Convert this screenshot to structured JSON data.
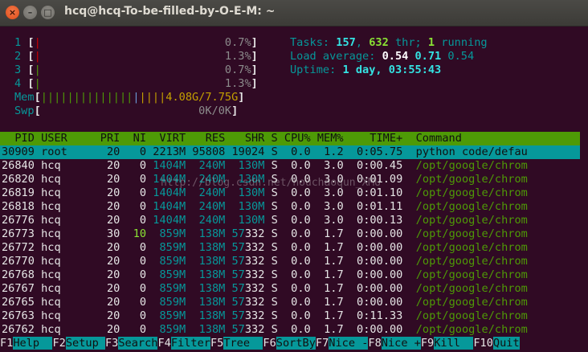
{
  "window": {
    "title": "hcq@hcq-To-be-filled-by-O-E-M: ~"
  },
  "meters": {
    "cpu": [
      {
        "num": "1",
        "bar": "|",
        "pct": "0.7%",
        "level": 0.007
      },
      {
        "num": "2",
        "bar": "|",
        "pct": "1.3%",
        "level": 0.013
      },
      {
        "num": "3",
        "bar": "|",
        "pct": "0.7%",
        "level": 0.007
      },
      {
        "num": "4",
        "bar": "|",
        "pct": "1.3%",
        "level": 0.013
      }
    ],
    "mem": {
      "label": "Mem",
      "bar_green": "||||||||||||||",
      "bar_blue": "|",
      "bar_yellow": "||||",
      "value": "4.08G/7.75G"
    },
    "swp": {
      "label": "Swp",
      "value": "0K/0K"
    }
  },
  "stats": {
    "tasks_label": "Tasks:",
    "tasks": "157",
    "thr": "632",
    "thr_label": "thr;",
    "running": "1",
    "running_label": "running",
    "load_label": "Load average:",
    "load1": "0.54",
    "load5": "0.71",
    "load15": "0.54",
    "uptime_label": "Uptime:",
    "uptime": "1 day, 03:55:43"
  },
  "table": {
    "columns": [
      "PID",
      "USER",
      "PRI",
      "NI",
      "VIRT",
      "RES",
      "SHR",
      "S",
      "CPU%",
      "MEM%",
      "TIME+",
      "Command"
    ],
    "rows": [
      {
        "pid": "30909",
        "user": "root",
        "pri": "20",
        "ni": "0",
        "virt": "2213M",
        "res": "95808",
        "shr": "19024",
        "s": "S",
        "cpu": "0.0",
        "mem": "1.2",
        "time": "0:05.75",
        "cmd": "python code/defau"
      },
      {
        "pid": "26840",
        "user": "hcq",
        "pri": "20",
        "ni": "0",
        "virt": "1404M",
        "res": "240M",
        "shr": "130M",
        "s": "S",
        "cpu": "0.0",
        "mem": "3.0",
        "time": "0:00.45",
        "cmd": "/opt/google/chrom"
      },
      {
        "pid": "26820",
        "user": "hcq",
        "pri": "20",
        "ni": "0",
        "virt": "1404M",
        "res": "240M",
        "shr": "130M",
        "s": "S",
        "cpu": "0.0",
        "mem": "3.0",
        "time": "0:01.09",
        "cmd": "/opt/google/chrom"
      },
      {
        "pid": "26819",
        "user": "hcq",
        "pri": "20",
        "ni": "0",
        "virt": "1404M",
        "res": "240M",
        "shr": "130M",
        "s": "S",
        "cpu": "0.0",
        "mem": "3.0",
        "time": "0:01.10",
        "cmd": "/opt/google/chrom"
      },
      {
        "pid": "26818",
        "user": "hcq",
        "pri": "20",
        "ni": "0",
        "virt": "1404M",
        "res": "240M",
        "shr": "130M",
        "s": "S",
        "cpu": "0.0",
        "mem": "3.0",
        "time": "0:01.11",
        "cmd": "/opt/google/chrom"
      },
      {
        "pid": "26776",
        "user": "hcq",
        "pri": "20",
        "ni": "0",
        "virt": "1404M",
        "res": "240M",
        "shr": "130M",
        "s": "S",
        "cpu": "0.0",
        "mem": "3.0",
        "time": "0:00.13",
        "cmd": "/opt/google/chrom"
      },
      {
        "pid": "26773",
        "user": "hcq",
        "pri": "30",
        "ni": "10",
        "virt": "859M",
        "res": "138M",
        "shr": "57332",
        "s": "S",
        "cpu": "0.0",
        "mem": "1.7",
        "time": "0:00.00",
        "cmd": "/opt/google/chrom"
      },
      {
        "pid": "26772",
        "user": "hcq",
        "pri": "20",
        "ni": "0",
        "virt": "859M",
        "res": "138M",
        "shr": "57332",
        "s": "S",
        "cpu": "0.0",
        "mem": "1.7",
        "time": "0:00.00",
        "cmd": "/opt/google/chrom"
      },
      {
        "pid": "26770",
        "user": "hcq",
        "pri": "20",
        "ni": "0",
        "virt": "859M",
        "res": "138M",
        "shr": "57332",
        "s": "S",
        "cpu": "0.0",
        "mem": "1.7",
        "time": "0:00.00",
        "cmd": "/opt/google/chrom"
      },
      {
        "pid": "26768",
        "user": "hcq",
        "pri": "20",
        "ni": "0",
        "virt": "859M",
        "res": "138M",
        "shr": "57332",
        "s": "S",
        "cpu": "0.0",
        "mem": "1.7",
        "time": "0:00.00",
        "cmd": "/opt/google/chrom"
      },
      {
        "pid": "26767",
        "user": "hcq",
        "pri": "20",
        "ni": "0",
        "virt": "859M",
        "res": "138M",
        "shr": "57332",
        "s": "S",
        "cpu": "0.0",
        "mem": "1.7",
        "time": "0:00.00",
        "cmd": "/opt/google/chrom"
      },
      {
        "pid": "26765",
        "user": "hcq",
        "pri": "20",
        "ni": "0",
        "virt": "859M",
        "res": "138M",
        "shr": "57332",
        "s": "S",
        "cpu": "0.0",
        "mem": "1.7",
        "time": "0:00.00",
        "cmd": "/opt/google/chrom"
      },
      {
        "pid": "26763",
        "user": "hcq",
        "pri": "20",
        "ni": "0",
        "virt": "859M",
        "res": "138M",
        "shr": "57332",
        "s": "S",
        "cpu": "0.0",
        "mem": "1.7",
        "time": "0:11.33",
        "cmd": "/opt/google/chrom"
      },
      {
        "pid": "26762",
        "user": "hcq",
        "pri": "20",
        "ni": "0",
        "virt": "859M",
        "res": "138M",
        "shr": "57332",
        "s": "S",
        "cpu": "0.0",
        "mem": "1.7",
        "time": "0:00.00",
        "cmd": "/opt/google/chrom"
      }
    ]
  },
  "watermark": "http://blog.csdn.net/houchaoqun_XMU",
  "footer": [
    {
      "key": "F1",
      "label": "Help  "
    },
    {
      "key": "F2",
      "label": "Setup "
    },
    {
      "key": "F3",
      "label": "Search"
    },
    {
      "key": "F4",
      "label": "Filter"
    },
    {
      "key": "F5",
      "label": "Tree  "
    },
    {
      "key": "F6",
      "label": "SortBy"
    },
    {
      "key": "F7",
      "label": "Nice -"
    },
    {
      "key": "F8",
      "label": "Nice +"
    },
    {
      "key": "F9",
      "label": "Kill  "
    },
    {
      "key": "F10",
      "label": "Quit"
    }
  ],
  "colors": {
    "background": "#300a24",
    "header_bg": "#4e9a06",
    "selected_bg": "#06989a",
    "cyan": "#34e2e2",
    "green": "#4e9a06"
  }
}
